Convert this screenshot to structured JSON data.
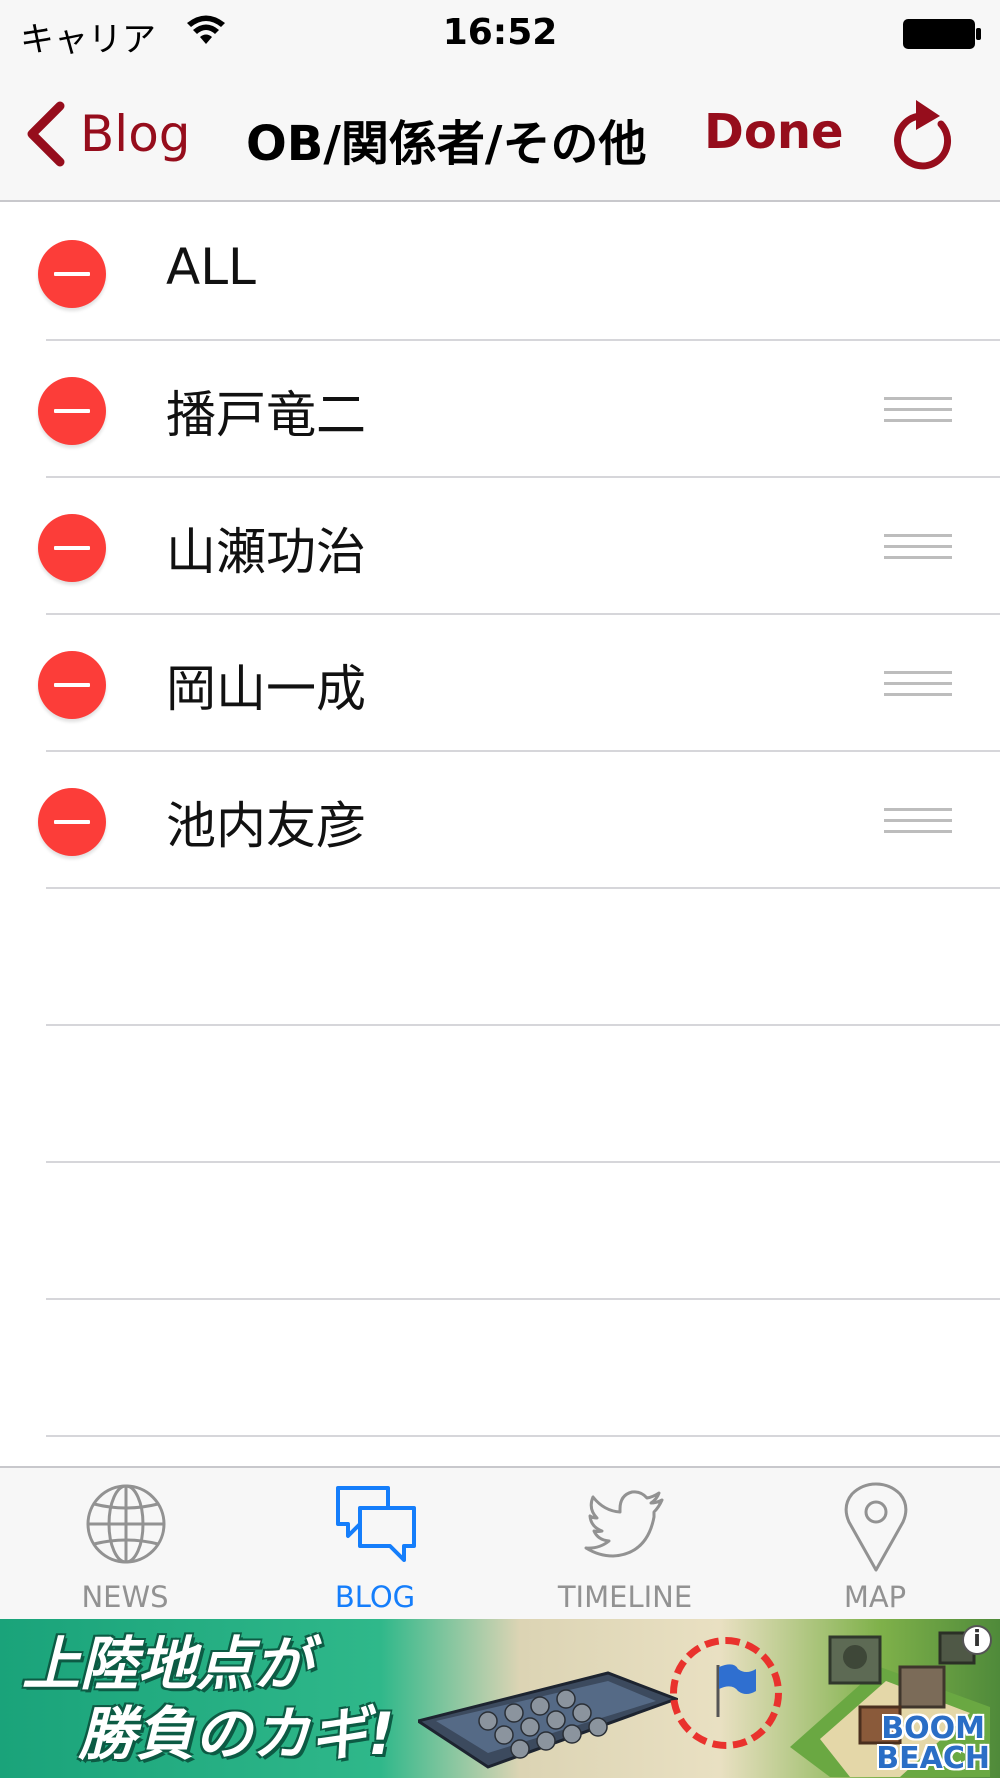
{
  "status_bar": {
    "carrier": "キャリア",
    "time": "16:52"
  },
  "nav": {
    "back_label": "Blog",
    "title": "OB/関係者/その他",
    "done_label": "Done",
    "accent_color": "#960d1c"
  },
  "list": {
    "items": [
      {
        "label": "ALL",
        "reorderable": false
      },
      {
        "label": "播戸竜二",
        "reorderable": true
      },
      {
        "label": "山瀬功治",
        "reorderable": true
      },
      {
        "label": "岡山一成",
        "reorderable": true
      },
      {
        "label": "池内友彦",
        "reorderable": true
      }
    ],
    "delete_color": "#fc3d39"
  },
  "tab_bar": {
    "tabs": [
      {
        "label": "NEWS",
        "icon": "globe-icon",
        "active": false
      },
      {
        "label": "BLOG",
        "icon": "chat-bubbles-icon",
        "active": true
      },
      {
        "label": "TIMELINE",
        "icon": "twitter-bird-icon",
        "active": false
      },
      {
        "label": "MAP",
        "icon": "map-pin-icon",
        "active": false
      }
    ],
    "active_color": "#157efb",
    "inactive_color": "#929292"
  },
  "ad": {
    "line1": "上陸地点が",
    "line2": "勝負のカギ!",
    "logo_line1": "BOOM",
    "logo_line2": "BEACH",
    "info": "i"
  }
}
